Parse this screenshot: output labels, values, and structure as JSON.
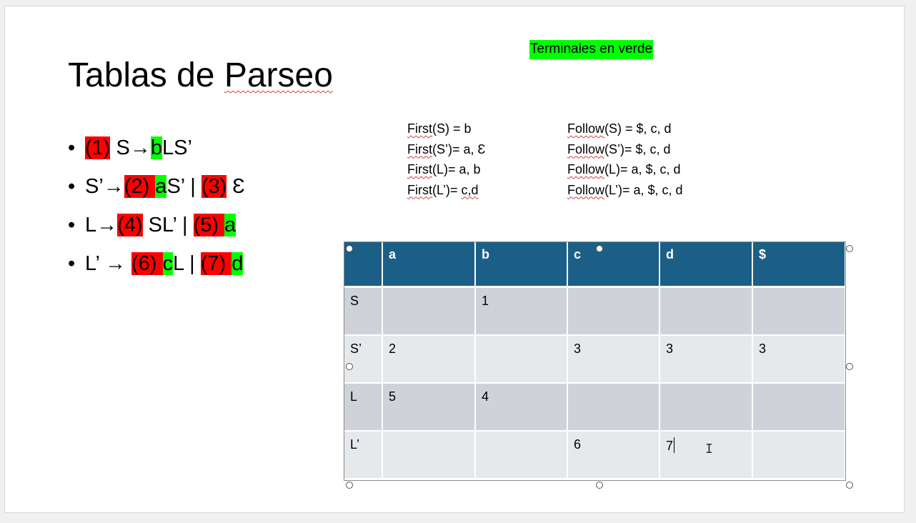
{
  "slide": {
    "title_part1": "Tablas de ",
    "title_part2": "Parseo",
    "note": "Terminales en verde"
  },
  "bullets": [
    {
      "segments": [
        {
          "text": "(1)",
          "hl": "r"
        },
        {
          "text": " S",
          "hl": ""
        },
        {
          "text": "→",
          "hl": ""
        },
        {
          "text": "b",
          "hl": "g"
        },
        {
          "text": "LS’",
          "hl": ""
        }
      ]
    },
    {
      "segments": [
        {
          "text": "S’",
          "hl": ""
        },
        {
          "text": "→",
          "hl": ""
        },
        {
          "text": "(2) ",
          "hl": "r"
        },
        {
          "text": "a",
          "hl": "g"
        },
        {
          "text": "S’ | ",
          "hl": ""
        },
        {
          "text": "(3)",
          "hl": "r"
        },
        {
          "text": " Ɛ",
          "hl": ""
        }
      ]
    },
    {
      "segments": [
        {
          "text": "L",
          "hl": ""
        },
        {
          "text": "→",
          "hl": ""
        },
        {
          "text": "(4)",
          "hl": "r"
        },
        {
          "text": " SL’ | ",
          "hl": ""
        },
        {
          "text": "(5) ",
          "hl": "r"
        },
        {
          "text": "a",
          "hl": "g"
        }
      ]
    },
    {
      "segments": [
        {
          "text": "L’ ",
          "hl": ""
        },
        {
          "text": "→",
          "hl": ""
        },
        {
          "text": " ",
          "hl": ""
        },
        {
          "text": "(6) ",
          "hl": "r"
        },
        {
          "text": "c",
          "hl": "g"
        },
        {
          "text": "L | ",
          "hl": ""
        },
        {
          "text": "(7) ",
          "hl": "r"
        },
        {
          "text": "d",
          "hl": "g"
        }
      ]
    }
  ],
  "first_sets": [
    {
      "label": "First",
      "rest": "(S) =  b"
    },
    {
      "label": "First",
      "rest": "(S’)= a, Ɛ"
    },
    {
      "label": "First",
      "rest": "(L)= a, b"
    },
    {
      "label": "First",
      "rest": "(L’)= ",
      "extra": "c,d"
    }
  ],
  "follow_sets": [
    {
      "label": "Follow",
      "rest": "(S) = $, c, d"
    },
    {
      "label": "Follow",
      "rest": "(S’)= $, c, d"
    },
    {
      "label": "Follow",
      "rest": "(L)=  a, $, c, d"
    },
    {
      "label": "Follow",
      "rest": "(L’)= a, $, c, d"
    }
  ],
  "table": {
    "headers": [
      "",
      "a",
      "b",
      "c",
      "d",
      "$"
    ],
    "rows": [
      [
        "S",
        "",
        "1",
        "",
        "",
        ""
      ],
      [
        "S’",
        "2",
        "",
        "3",
        "3",
        "3"
      ],
      [
        "L",
        "5",
        "4",
        "",
        "",
        ""
      ],
      [
        "L’",
        "",
        "",
        "6",
        "7",
        ""
      ]
    ]
  },
  "colors": {
    "nonterminal_highlight": "#ff0000",
    "terminal_highlight": "#00ff00",
    "table_header": "#1b5f86",
    "row_dark": "#cfd3d9",
    "row_light": "#e6e9ec"
  }
}
